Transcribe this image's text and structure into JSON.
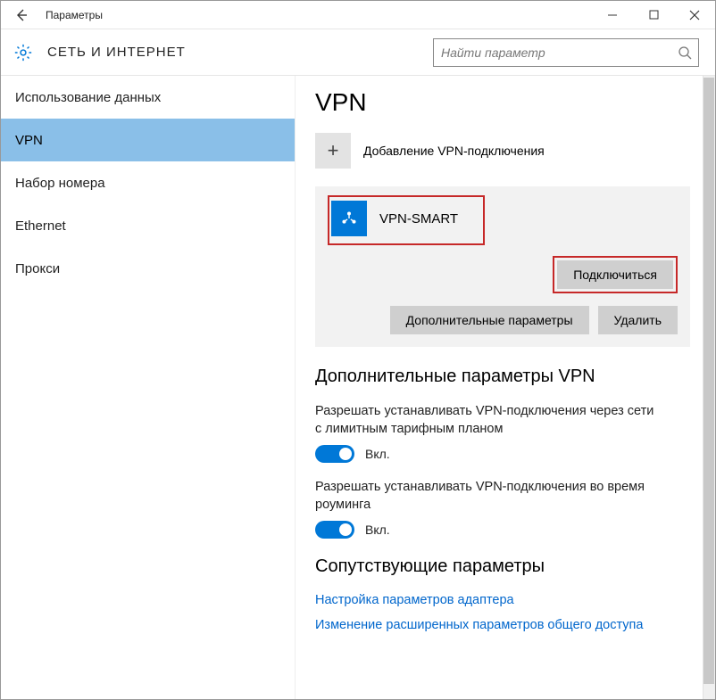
{
  "titlebar": {
    "title": "Параметры"
  },
  "header": {
    "section_title": "СЕТЬ И ИНТЕРНЕТ",
    "search_placeholder": "Найти параметр"
  },
  "sidebar": {
    "items": [
      {
        "label": "Использование данных"
      },
      {
        "label": "VPN"
      },
      {
        "label": "Набор номера"
      },
      {
        "label": "Ethernet"
      },
      {
        "label": "Прокси"
      }
    ],
    "active_index": 1
  },
  "main": {
    "title": "VPN",
    "add_label": "Добавление VPN-подключения",
    "connection": {
      "name": "VPN-SMART",
      "connect_btn": "Подключиться",
      "advanced_btn": "Дополнительные параметры",
      "delete_btn": "Удалить"
    },
    "adv_heading": "Дополнительные параметры VPN",
    "setting1": {
      "desc": "Разрешать устанавливать VPN-подключения через сети с лимитным тарифным планом",
      "state": "Вкл."
    },
    "setting2": {
      "desc": "Разрешать устанавливать VPN-подключения во время роуминга",
      "state": "Вкл."
    },
    "related_heading": "Сопутствующие параметры",
    "link1": "Настройка параметров адаптера",
    "link2": "Изменение расширенных параметров общего доступа"
  }
}
